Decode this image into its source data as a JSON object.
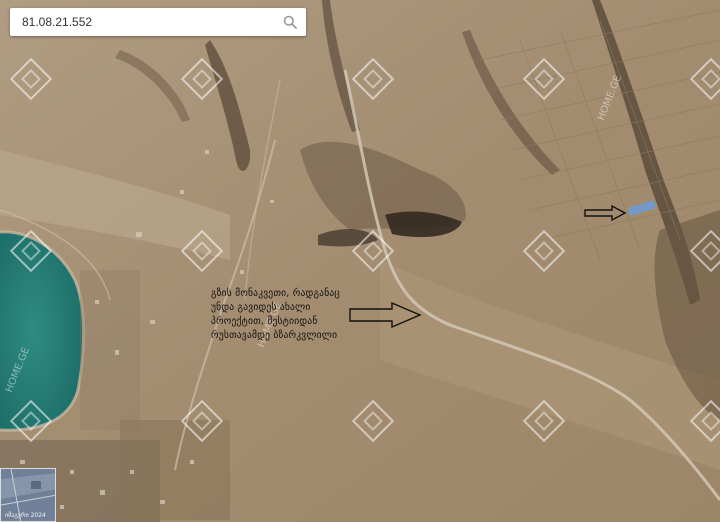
{
  "search": {
    "value": "81.08.21.552",
    "icon": "search-icon"
  },
  "annotation": {
    "lines": [
      "გზის მონაკვეთი, რადგანაც",
      "უნდა გავიდეს ახალი",
      "პროექტით, მესტიიდან",
      "რუსთავამდე ბზარკვლილი"
    ]
  },
  "markers": {
    "plot_highlight_color": "#6a9bd8",
    "arrow_color": "#111111"
  },
  "watermark": {
    "text": "HOME.GE"
  },
  "thumbnail": {
    "label": "იმაგერი 2024"
  }
}
